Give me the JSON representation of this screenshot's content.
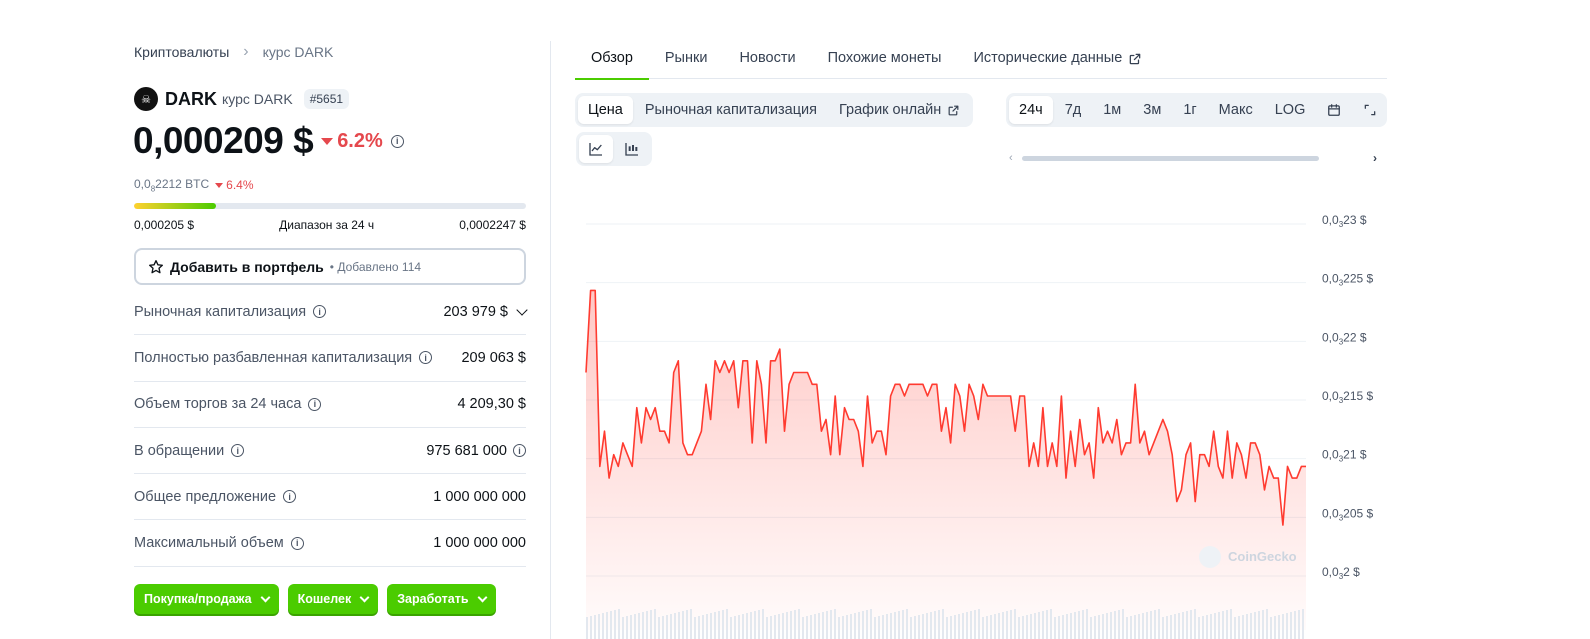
{
  "breadcrumb": {
    "root": "Криптовалюты",
    "current": "курс DARK"
  },
  "coin": {
    "symbol": "DARK",
    "subtitle": "курс DARK",
    "rank": "#5651",
    "logo_glyph": "☠"
  },
  "price": {
    "value": "0,000209 $",
    "change": "6.2%",
    "btc_value_prefix": "0,0",
    "btc_value_sub": "8",
    "btc_value_suffix": "2212 BTC",
    "btc_change": "6.4%"
  },
  "range_24h": {
    "low": "0,000205 $",
    "label": "Диапазон за 24 ч",
    "high": "0,0002247 $",
    "position": 0.21
  },
  "portfolio": {
    "label": "Добавить в портфель",
    "added": "• Добавлено 114"
  },
  "stats": [
    {
      "label": "Рыночная капитализация",
      "value": "203 979 $"
    },
    {
      "label": "Полностью разбавленная капитализация",
      "value": "209 063 $"
    },
    {
      "label": "Объем торгов за 24 часа",
      "value": "4 209,30 $"
    },
    {
      "label": "В обращении",
      "value": "975 681 000"
    },
    {
      "label": "Общее предложение",
      "value": "1 000 000 000"
    },
    {
      "label": "Максимальный объем",
      "value": "1 000 000 000"
    }
  ],
  "actions": {
    "buy_sell": "Покупка/продажа",
    "wallet": "Кошелек",
    "earn": "Заработать"
  },
  "tabs": [
    {
      "label": "Обзор"
    },
    {
      "label": "Рынки"
    },
    {
      "label": "Новости"
    },
    {
      "label": "Похожие монеты"
    },
    {
      "label": "Исторические данные"
    }
  ],
  "chart_mode": {
    "price": "Цена",
    "market_cap": "Рыночная капитализация",
    "live": "График онлайн"
  },
  "ranges": [
    "24ч",
    "7д",
    "1м",
    "3м",
    "1г",
    "Макс",
    "LOG"
  ],
  "watermark": "CoinGecko",
  "colors": {
    "accent": "#4bcc00",
    "down": "#e5484d",
    "line": "#ff3b30"
  },
  "chart_data": {
    "type": "area",
    "title": "",
    "xlabel": "",
    "ylabel": "",
    "y_ticks": [
      {
        "pre": "0,0",
        "sub": "3",
        "post": "23 $",
        "value": 0.000223
      },
      {
        "pre": "0,0",
        "sub": "3",
        "post": "225 $",
        "value": 0.0002225
      },
      {
        "pre": "0,0",
        "sub": "3",
        "post": "22 $",
        "value": 0.000222
      },
      {
        "pre": "0,0",
        "sub": "3",
        "post": "215 $",
        "value": 0.0002215
      },
      {
        "pre": "0,0",
        "sub": "3",
        "post": "21 $",
        "value": 0.000221
      },
      {
        "pre": "0,0",
        "sub": "3",
        "post": "205 $",
        "value": 0.0002205
      },
      {
        "pre": "0,0",
        "sub": "3",
        "post": "2 $",
        "value": 0.00022
      }
    ],
    "ylim": [
      0.00022,
      0.000223
    ],
    "series": [
      {
        "values": [
          0.0002217,
          0.0002224,
          0.0002224,
          0.0002209,
          0.0002212,
          0.0002208,
          0.000221,
          0.0002209,
          0.0002211,
          0.000221,
          0.0002209,
          0.0002214,
          0.0002211,
          0.0002214,
          0.0002213,
          0.0002214,
          0.0002212,
          0.0002212,
          0.0002211,
          0.0002217,
          0.0002218,
          0.0002211,
          0.000221,
          0.000221,
          0.0002211,
          0.0002212,
          0.0002216,
          0.0002213,
          0.0002218,
          0.0002217,
          0.0002218,
          0.0002217,
          0.0002218,
          0.0002214,
          0.0002218,
          0.0002218,
          0.0002211,
          0.0002218,
          0.0002216,
          0.0002211,
          0.0002218,
          0.0002218,
          0.0002219,
          0.0002212,
          0.0002216,
          0.0002217,
          0.0002217,
          0.0002217,
          0.0002217,
          0.0002216,
          0.0002216,
          0.0002212,
          0.0002213,
          0.000221,
          0.0002215,
          0.000221,
          0.0002214,
          0.0002213,
          0.0002213,
          0.0002212,
          0.0002209,
          0.0002215,
          0.0002211,
          0.0002212,
          0.0002212,
          0.000221,
          0.0002215,
          0.0002216,
          0.0002216,
          0.0002215,
          0.0002216,
          0.0002216,
          0.0002216,
          0.0002216,
          0.0002215,
          0.0002216,
          0.0002216,
          0.0002212,
          0.0002214,
          0.0002211,
          0.0002216,
          0.0002215,
          0.0002212,
          0.0002216,
          0.0002215,
          0.0002213,
          0.0002216,
          0.0002215,
          0.0002215,
          0.0002215,
          0.0002215,
          0.0002215,
          0.0002215,
          0.0002212,
          0.0002215,
          0.0002215,
          0.0002209,
          0.0002211,
          0.0002209,
          0.0002214,
          0.0002209,
          0.0002211,
          0.0002209,
          0.0002215,
          0.0002208,
          0.0002212,
          0.0002209,
          0.0002213,
          0.000221,
          0.0002211,
          0.0002208,
          0.0002214,
          0.0002211,
          0.0002212,
          0.0002211,
          0.0002213,
          0.000221,
          0.0002211,
          0.0002211,
          0.0002216,
          0.0002211,
          0.0002212,
          0.000221,
          0.0002211,
          0.0002212,
          0.0002213,
          0.0002212,
          0.000221,
          0.0002206,
          0.0002207,
          0.000221,
          0.0002211,
          0.0002206,
          0.000221,
          0.000221,
          0.0002209,
          0.0002212,
          0.0002209,
          0.0002208,
          0.0002212,
          0.0002208,
          0.0002211,
          0.000221,
          0.0002208,
          0.0002211,
          0.0002211,
          0.000221,
          0.0002207,
          0.0002209,
          0.0002208,
          0.0002208,
          0.0002204,
          0.0002209,
          0.0002208,
          0.0002208,
          0.0002209,
          0.0002209
        ]
      }
    ],
    "volume_bars": true,
    "grid": true
  }
}
